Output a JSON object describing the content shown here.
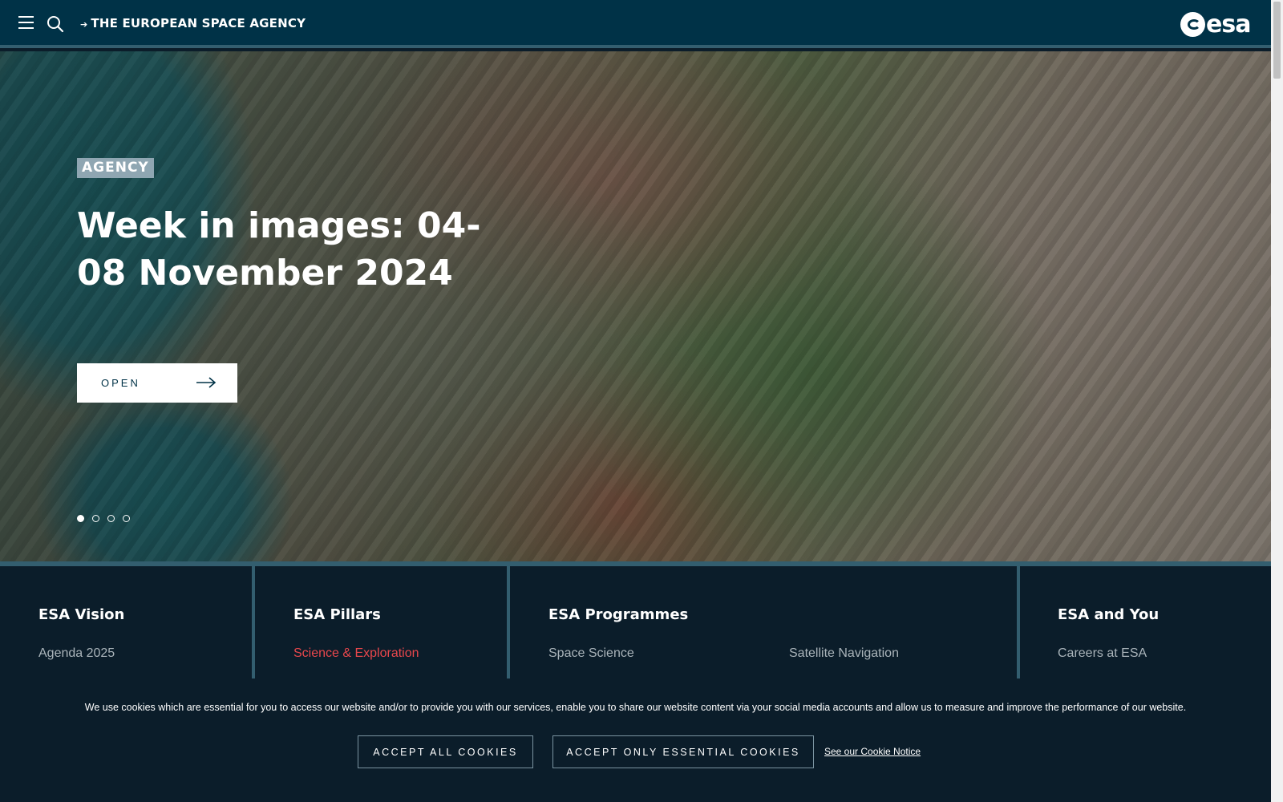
{
  "header": {
    "agency_link": "THE EUROPEAN SPACE AGENCY",
    "logo_text": "esa"
  },
  "hero": {
    "tag": "AGENCY",
    "title": "Week in images: 04-08 November 2024",
    "open_label": "OPEN",
    "slides": 4,
    "active_slide": 1
  },
  "columns": [
    {
      "heading": "ESA Vision",
      "links": [
        "Agenda 2025"
      ]
    },
    {
      "heading": "ESA Pillars",
      "links": [
        "Science & Exploration"
      ]
    },
    {
      "heading": "ESA Programmes",
      "links": [
        "Space Science",
        "Satellite Navigation"
      ]
    },
    {
      "heading": "ESA and You",
      "links": [
        "Careers at ESA"
      ]
    }
  ],
  "cookie": {
    "message": "We use cookies which are essential for you to access our website and/or to provide you with our services, enable you to share our website content via your social media accounts and allow us to measure and improve the performance of our website.",
    "accept_all": "ACCEPT ALL COOKIES",
    "accept_essential": "ACCEPT ONLY ESSENTIAL COOKIES",
    "notice_link": "See our Cookie Notice"
  },
  "colors": {
    "header_bg": "#003247",
    "accent_red": "#e8474c",
    "tag_bg": "#8fa6b2"
  }
}
